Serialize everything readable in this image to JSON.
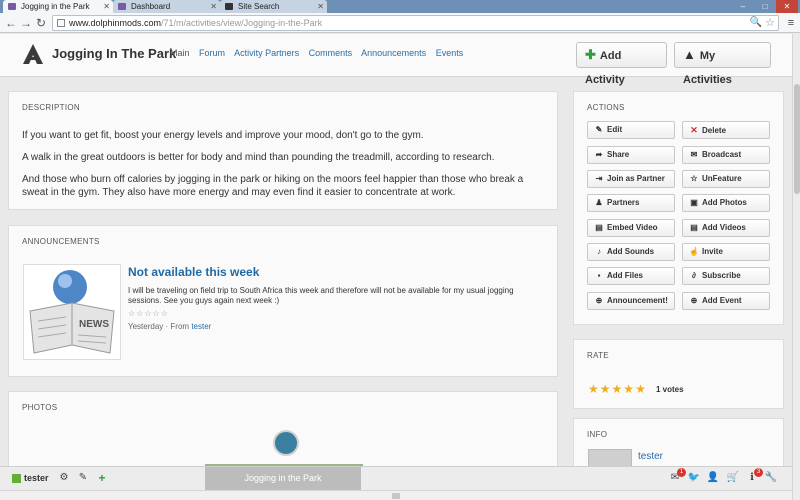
{
  "browser": {
    "tabs": [
      {
        "label": "Jogging in the Park",
        "active": true
      },
      {
        "label": "Dashboard",
        "active": false
      },
      {
        "label": "Site Search",
        "active": false
      }
    ],
    "url_host": "www.dolphinmods.com",
    "url_path": "/71/m/activities/view/Jogging-in-the-Park"
  },
  "header": {
    "title": "Jogging In The Park",
    "nav": [
      "Main",
      "Forum",
      "Activity Partners",
      "Comments",
      "Announcements",
      "Events"
    ],
    "add_activity": "Add Activity",
    "my_activities": "My Activities"
  },
  "description": {
    "heading": "DESCRIPTION",
    "paragraphs": [
      "If you want to get fit, boost your energy levels and improve your mood, don't go to the gym.",
      "A walk in the great outdoors is better for body and mind than pounding the treadmill, according to research.",
      "And those who burn off calories by jogging in the park or hiking on the moors feel happier than those who break a sweat in the gym. They also have more energy and may even find it easier to concentrate at work."
    ]
  },
  "announcements": {
    "heading": "ANNOUNCEMENTS",
    "item": {
      "title": "Not available this week",
      "text": "I will be traveling on field trip to South Africa this week and therefore will not be available for my usual jogging sessions. See you guys again next week :)",
      "stars": "☆☆☆☆☆",
      "time": "Yesterday",
      "from_label": "From",
      "author": "tester",
      "image_text": "NEWS"
    }
  },
  "photos": {
    "heading": "PHOTOS"
  },
  "actions": {
    "heading": "ACTIONS",
    "buttons": [
      {
        "label": "Edit",
        "icon": "edit-icon"
      },
      {
        "label": "Delete",
        "icon": "delete-icon"
      },
      {
        "label": "Share",
        "icon": "share-icon"
      },
      {
        "label": "Broadcast",
        "icon": "envelope-icon"
      },
      {
        "label": "Join as Partner",
        "icon": "sign-in-icon"
      },
      {
        "label": "UnFeature",
        "icon": "star-icon"
      },
      {
        "label": "Partners",
        "icon": "users-icon"
      },
      {
        "label": "Add Photos",
        "icon": "photo-icon"
      },
      {
        "label": "Embed Video",
        "icon": "film-icon"
      },
      {
        "label": "Add Videos",
        "icon": "film-icon"
      },
      {
        "label": "Add Sounds",
        "icon": "music-icon"
      },
      {
        "label": "Invite",
        "icon": "thumbs-up-icon"
      },
      {
        "label": "Add Files",
        "icon": "save-icon"
      },
      {
        "label": "Subscribe",
        "icon": "paperclip-icon"
      },
      {
        "label": "Announcement!",
        "icon": "plus-circle-icon"
      },
      {
        "label": "Add Event",
        "icon": "plus-circle-icon"
      }
    ]
  },
  "rate": {
    "heading": "RATE",
    "stars": 5,
    "votes": "1 votes"
  },
  "info": {
    "heading": "INFO",
    "user": "tester"
  },
  "footer": {
    "user": "tester",
    "caption": "Jogging in the Park",
    "mail_badge": "1",
    "info_badge": "3"
  },
  "colors": {
    "link": "#2a6fa8",
    "announcement_title": "#1e6aa6",
    "star": "#f0ad1e",
    "delete": "#c9302c",
    "add_green": "#2e9e3a"
  }
}
